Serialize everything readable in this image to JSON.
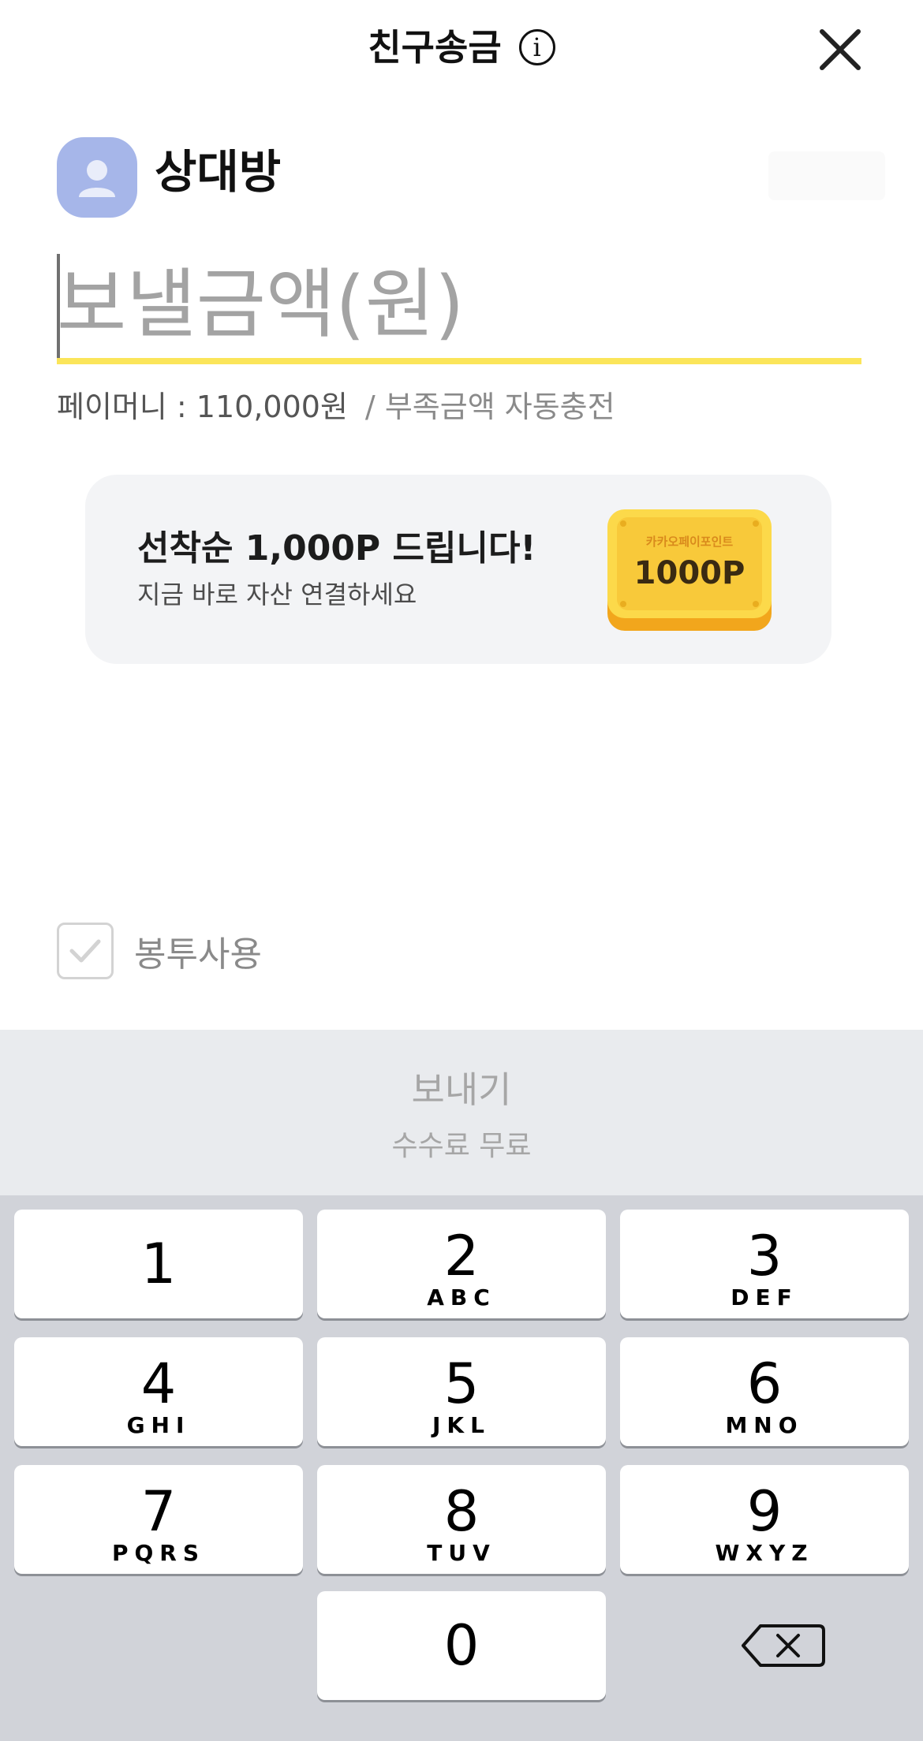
{
  "header": {
    "title": "친구송금",
    "info_icon": "info-icon",
    "close_icon": "close-icon"
  },
  "recipient": {
    "name": "상대방",
    "avatar_icon": "person-icon",
    "avatar_color": "#a6b6e9"
  },
  "amount": {
    "placeholder": "보낼금액(원)",
    "value": "",
    "underline_color": "#fbe55a"
  },
  "balance": {
    "label": "페이머니 : 110,000원",
    "separator": "/",
    "auto_charge": "부족금액 자동충전"
  },
  "promo": {
    "title": "선착순 1,000P 드립니다!",
    "subtitle": "지금 바로 자산 연결하세요",
    "coin_caption": "카카오페이포인트",
    "coin_value": "1000P"
  },
  "envelope": {
    "label": "봉투사용",
    "checked": false
  },
  "send": {
    "label": "보내기",
    "fee": "수수료 무료"
  },
  "keypad": {
    "keys": [
      {
        "num": "1",
        "letters": ""
      },
      {
        "num": "2",
        "letters": "ABC"
      },
      {
        "num": "3",
        "letters": "DEF"
      },
      {
        "num": "4",
        "letters": "GHI"
      },
      {
        "num": "5",
        "letters": "JKL"
      },
      {
        "num": "6",
        "letters": "MNO"
      },
      {
        "num": "7",
        "letters": "PQRS"
      },
      {
        "num": "8",
        "letters": "TUV"
      },
      {
        "num": "9",
        "letters": "WXYZ"
      },
      {
        "num": "0",
        "letters": ""
      }
    ],
    "delete_icon": "backspace-icon"
  }
}
